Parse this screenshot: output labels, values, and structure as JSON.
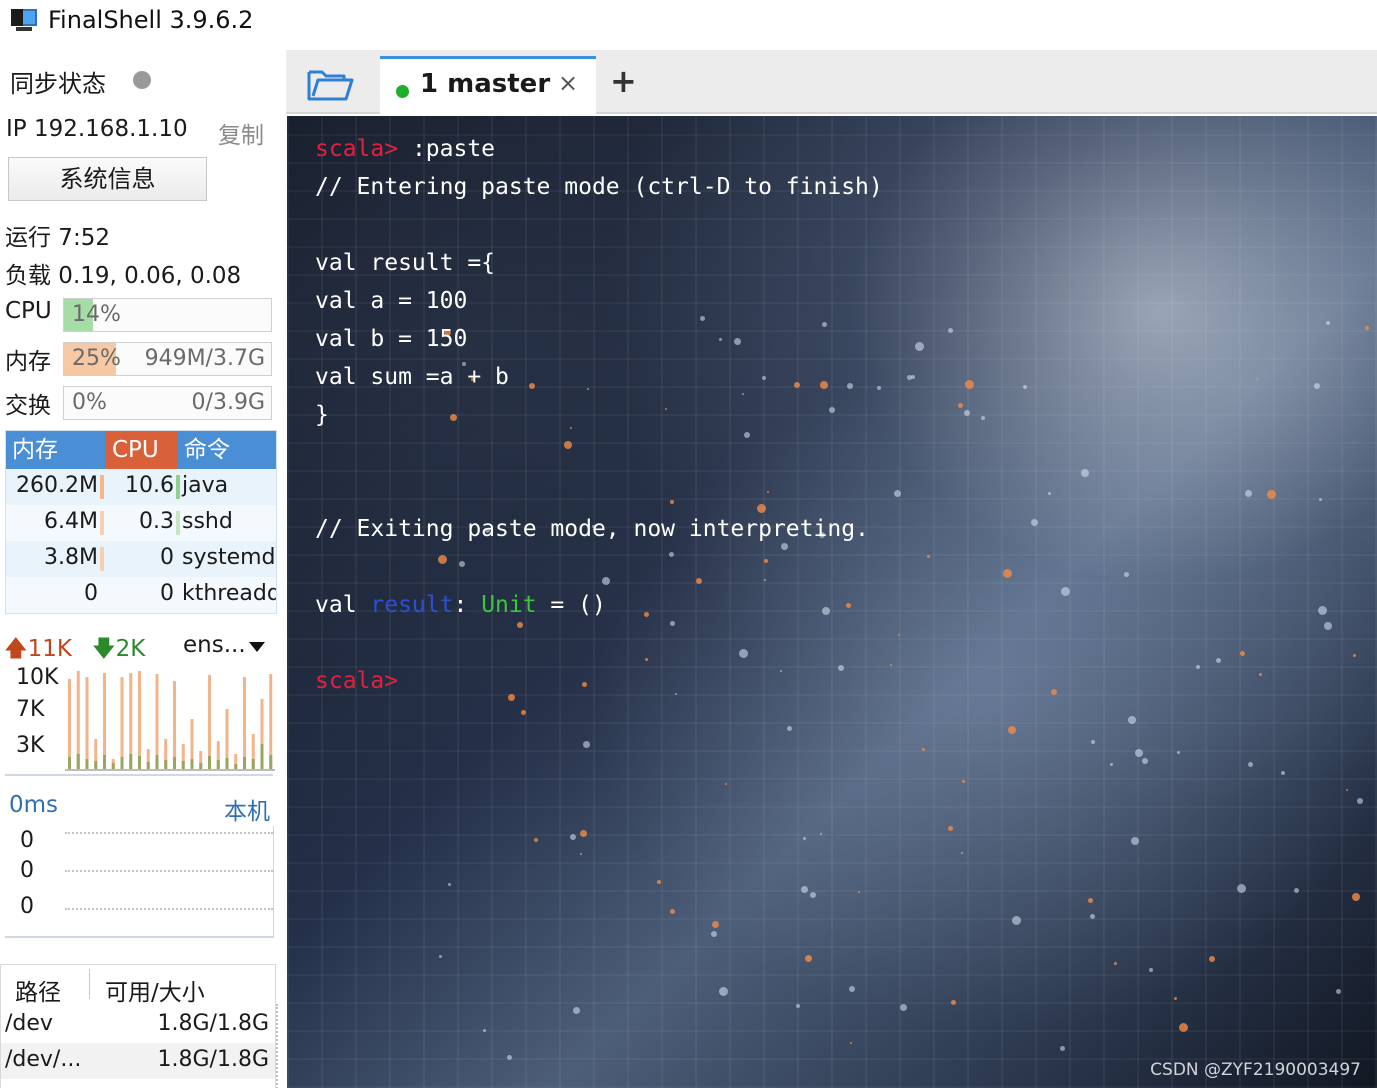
{
  "window": {
    "title": "FinalShell 3.9.6.2"
  },
  "sidebar": {
    "sync_label": "同步状态",
    "ip_label": "IP 192.168.1.10",
    "copy_label": "复制",
    "sysinfo_button": "系统信息",
    "uptime": "运行 7:52",
    "load": "负载 0.19, 0.06, 0.08",
    "cpu": {
      "label": "CPU",
      "text": "14%",
      "percent": 14,
      "color": "#a6dca6"
    },
    "mem": {
      "label": "内存",
      "text": "25%",
      "detail": "949M/3.7G",
      "percent": 25,
      "color": "#f6c9a4"
    },
    "swap": {
      "label": "交换",
      "text": "0%",
      "detail": "0/3.9G",
      "percent": 0
    },
    "process_table": {
      "headers": [
        "内存",
        "CPU",
        "命令"
      ],
      "header_colors": [
        "#4a8fd6",
        "#d9613a",
        "#4a8fd6"
      ],
      "rows": [
        {
          "mem": "260.2M",
          "cpu": "10.6",
          "cmd": "java"
        },
        {
          "mem": "6.4M",
          "cpu": "0.3",
          "cmd": "sshd"
        },
        {
          "mem": "3.8M",
          "cpu": "0",
          "cmd": "systemd"
        },
        {
          "mem": "0",
          "cpu": "0",
          "cmd": "kthreadd"
        }
      ]
    },
    "network": {
      "up": "11K",
      "down": "2K",
      "interface": "ens...",
      "ticks": [
        "10K",
        "7K",
        "3K"
      ],
      "upload_bars": [
        90,
        98,
        92,
        30,
        96,
        10,
        92,
        96,
        98,
        20,
        95,
        30,
        88,
        25,
        50,
        18,
        94,
        28,
        60,
        15,
        92,
        35,
        70,
        95
      ],
      "download_bars": [
        12,
        15,
        10,
        8,
        14,
        6,
        12,
        15,
        13,
        7,
        14,
        9,
        12,
        8,
        10,
        6,
        13,
        9,
        11,
        5,
        12,
        10,
        25,
        14
      ]
    },
    "latency": {
      "ms": "0ms",
      "host": "本机",
      "values": [
        "0",
        "0",
        "0"
      ]
    },
    "filesystem": {
      "header_path": "路径",
      "header_size": "可用/大小",
      "rows": [
        {
          "path": "/dev",
          "size": "1.8G/1.8G"
        },
        {
          "path": "/dev/...",
          "size": "1.8G/1.8G"
        }
      ]
    }
  },
  "tabs": {
    "active_label": "1 master",
    "close_icon": "×",
    "add_icon": "+"
  },
  "terminal": {
    "lines": [
      {
        "segments": [
          {
            "t": "scala>",
            "c": "prompt"
          },
          {
            "t": " :paste",
            "c": ""
          }
        ]
      },
      {
        "segments": [
          {
            "t": "// Entering paste mode (ctrl-D to finish)",
            "c": ""
          }
        ]
      },
      {
        "segments": [
          {
            "t": "",
            "c": ""
          }
        ]
      },
      {
        "segments": [
          {
            "t": "val result ={",
            "c": ""
          }
        ]
      },
      {
        "segments": [
          {
            "t": "val a = 100",
            "c": ""
          }
        ]
      },
      {
        "segments": [
          {
            "t": "val b = 150",
            "c": ""
          }
        ]
      },
      {
        "segments": [
          {
            "t": "val sum =a + b",
            "c": ""
          }
        ]
      },
      {
        "segments": [
          {
            "t": "}",
            "c": ""
          }
        ]
      },
      {
        "segments": [
          {
            "t": "",
            "c": ""
          }
        ]
      },
      {
        "segments": [
          {
            "t": "",
            "c": ""
          }
        ]
      },
      {
        "segments": [
          {
            "t": "// Exiting paste mode, now interpreting.",
            "c": ""
          }
        ]
      },
      {
        "segments": [
          {
            "t": "",
            "c": ""
          }
        ]
      },
      {
        "segments": [
          {
            "t": "val ",
            "c": ""
          },
          {
            "t": "result",
            "c": "id"
          },
          {
            "t": ": ",
            "c": ""
          },
          {
            "t": "Unit",
            "c": "type"
          },
          {
            "t": " = ()",
            "c": ""
          }
        ]
      },
      {
        "segments": [
          {
            "t": "",
            "c": ""
          }
        ]
      },
      {
        "segments": [
          {
            "t": "scala>",
            "c": "prompt"
          }
        ]
      }
    ],
    "watermark": "CSDN @ZYF2190003497"
  }
}
